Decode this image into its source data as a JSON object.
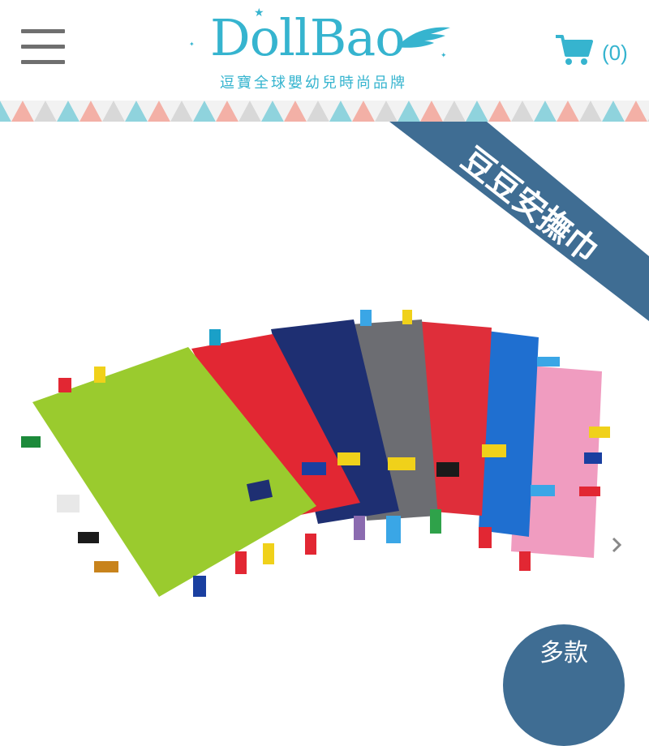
{
  "header": {
    "logo_text": "DollBao",
    "logo_subtitle": "逗寶全球嬰幼兒時尚品牌",
    "cart_count": "(0)"
  },
  "hero": {
    "ribbon_text": "豆豆安撫巾",
    "badge_text": "多款"
  },
  "icons": {
    "menu": "hamburger-icon",
    "cart": "shopping-cart-icon",
    "next": "chevron-right-icon"
  },
  "colors": {
    "brand": "#36b4cf",
    "ribbon": "#3f6d93",
    "triangle_teal": "#8fd3dd",
    "triangle_pink": "#f3b0a6"
  }
}
